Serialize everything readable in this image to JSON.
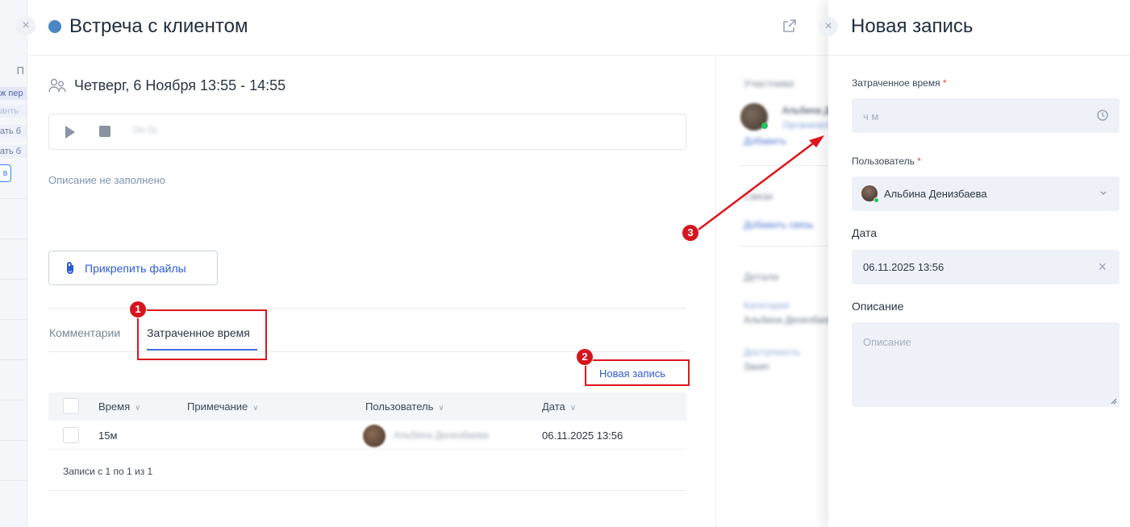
{
  "background_app": {
    "header_letter": "П",
    "chips": [
      "ж пер",
      "анть",
      "ать б",
      "ать б"
    ],
    "box_letter": "в"
  },
  "task": {
    "title": "Встреча с клиентом",
    "status_color": "#4a86c5",
    "datetime": "Четверг, 6 Ноября 13:55 - 14:55",
    "player_time": "0м 0с",
    "description_empty": "Описание не заполнено",
    "attach_label": "Прикрепить файлы"
  },
  "tabs": [
    {
      "label": "Комментарии",
      "active": false
    },
    {
      "label": "Затраченное время",
      "active": true
    }
  ],
  "new_record_link": "Новая запись",
  "table": {
    "columns": [
      "Время",
      "Примечание",
      "Пользователь",
      "Дата"
    ],
    "rows": [
      {
        "time": "15м",
        "note": "",
        "user": "Альбина Денизбаева",
        "date": "06.11.2025 13:56"
      }
    ],
    "footer": "Записи с 1 по 1 из 1"
  },
  "right_column": {
    "participants_title": "Участники",
    "participant_name": "Альбина Денизбаева",
    "participant_role": "Организатор",
    "add_participant": "Добавить",
    "links_title": "Связи",
    "add_link": "Добавить связь",
    "details_title": "Детали",
    "detail_1_label": "Категория",
    "detail_1_value": "Альбина Денизбаева",
    "detail_2_label": "Доступность",
    "detail_2_value": "Занят"
  },
  "side_panel": {
    "title": "Новая запись",
    "time_label": "Затраченное время",
    "time_placeholder": "ч м",
    "user_label": "Пользователь",
    "user_value": "Альбина Денизбаева",
    "date_label": "Дата",
    "date_value": "06.11.2025 13:56",
    "desc_label": "Описание",
    "desc_placeholder": "Описание",
    "required_mark": "*"
  },
  "annotations": {
    "markers": [
      "1",
      "2",
      "3"
    ],
    "color": "#e0141c"
  },
  "icons": [
    "close-icon",
    "external-link-icon",
    "people-icon",
    "play-icon",
    "stop-icon",
    "paperclip-icon",
    "chevron-down-icon",
    "clock-icon",
    "clear-icon",
    "resize-icon"
  ]
}
